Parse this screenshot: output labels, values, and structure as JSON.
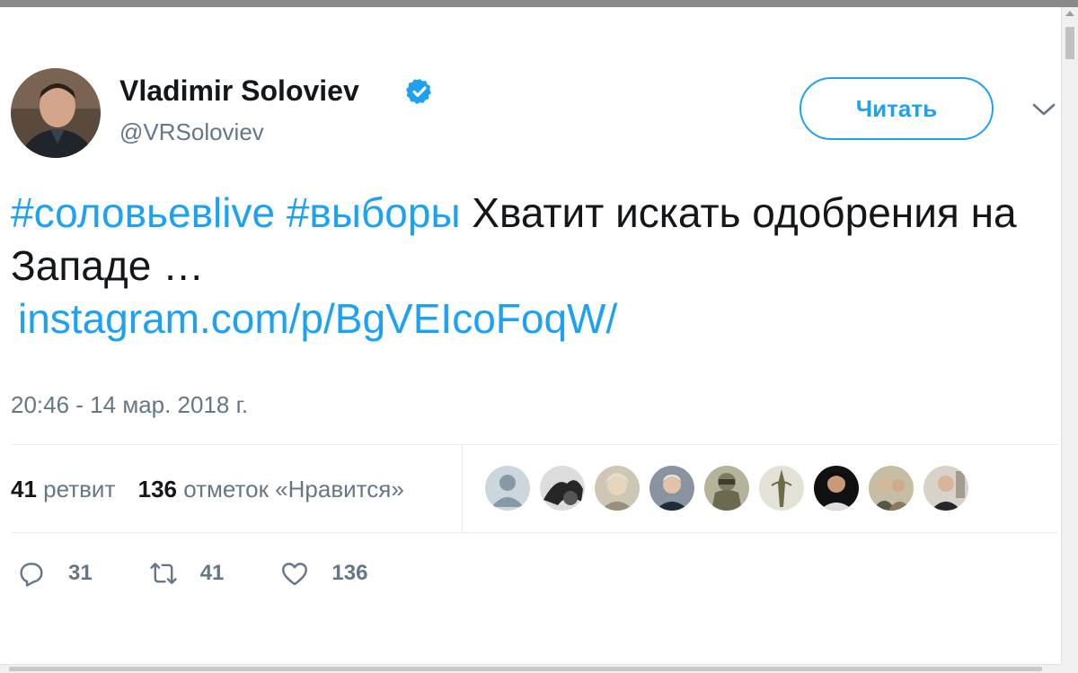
{
  "profile": {
    "name": "Vladimir Soloviev",
    "handle": "@VRSoloviev",
    "verified_icon": "verified-badge-icon"
  },
  "follow_button": {
    "label": "Читать"
  },
  "tweet": {
    "hashtags": [
      "#соловьевlive",
      "#выборы"
    ],
    "text": "Хватит искать одобрения на Западе …",
    "link": "instagram.com/p/BgVEIcoFoqW/",
    "timestamp": "20:46 - 14 мар. 2018 г."
  },
  "stats": {
    "retweets_count": "41",
    "retweets_label": "ретвит",
    "likes_count": "136",
    "likes_label": "отметок «Нравится»"
  },
  "actions": {
    "reply_count": "31",
    "retweet_count": "41",
    "like_count": "136"
  },
  "colors": {
    "accent": "#1da1f2",
    "secondary_text": "#657786",
    "primary_text": "#14171a",
    "divider": "#e6ecf0"
  }
}
